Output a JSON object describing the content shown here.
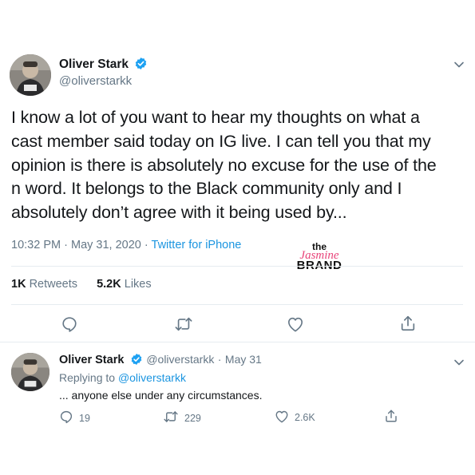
{
  "tweet": {
    "author_name": "Oliver Stark",
    "author_handle": "@oliverstarkk",
    "text_lines": [
      "I know a lot of you want to hear my thoughts on what a",
      "cast member said today on IG live. I can tell you that my",
      "opinion is there is absolutely no excuse for the use of the",
      "n word. It belongs to the Black community only and I",
      "absolutely don’t agree with it being used by..."
    ],
    "time": "10:32 PM",
    "date": "May 31, 2020",
    "separator": "·",
    "source": "Twitter for iPhone",
    "retweets_count": "1K",
    "retweets_label": "Retweets",
    "likes_count": "5.2K",
    "likes_label": "Likes"
  },
  "watermark": {
    "line1": "the",
    "line2": "Jasmine",
    "line3": "BRAND"
  },
  "reply": {
    "author_name": "Oliver Stark",
    "author_handle": "@oliverstarkk",
    "separator": "·",
    "date": "May 31",
    "replying_prefix": "Replying to",
    "replying_handle": "@oliverstarkk",
    "text": "... anyone else under any circumstances.",
    "reply_count": "19",
    "retweet_count": "229",
    "like_count": "2.6K"
  },
  "colors": {
    "link": "#1b95e0",
    "verified": "#1da1f2",
    "secondary_text": "#657786",
    "divider": "#e6ecf0",
    "watermark_pink": "#e8447a"
  },
  "icons": [
    "verified-badge-icon",
    "chevron-down-icon",
    "reply-icon",
    "retweet-icon",
    "like-icon",
    "share-icon"
  ]
}
